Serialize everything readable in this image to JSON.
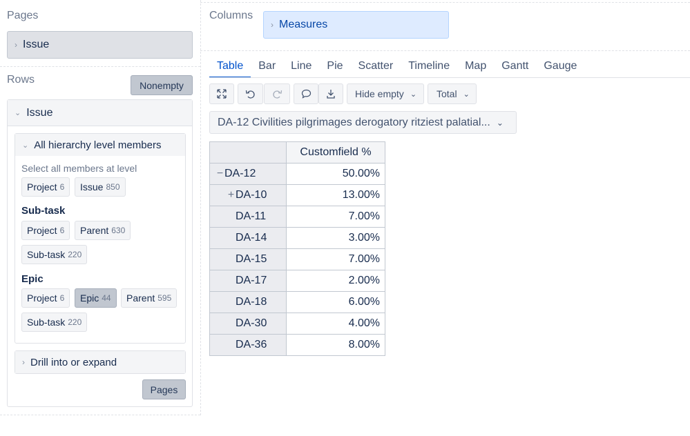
{
  "pages": {
    "title": "Pages",
    "item": "Issue"
  },
  "rows": {
    "title": "Rows",
    "nonempty_button": "Nonempty",
    "dimension": "Issue",
    "all_levels": {
      "header": "All hierarchy level members",
      "hint": "Select all members at level",
      "top_chips": [
        {
          "label": "Project",
          "count": "6"
        },
        {
          "label": "Issue",
          "count": "850"
        }
      ],
      "subtask_group": "Sub-task",
      "subtask_chips": [
        {
          "label": "Project",
          "count": "6"
        },
        {
          "label": "Parent",
          "count": "630"
        },
        {
          "label": "Sub-task",
          "count": "220"
        }
      ],
      "epic_group": "Epic",
      "epic_chips": [
        {
          "label": "Project",
          "count": "6"
        },
        {
          "label": "Epic",
          "count": "44"
        },
        {
          "label": "Parent",
          "count": "595"
        },
        {
          "label": "Sub-task",
          "count": "220"
        }
      ]
    },
    "drill": "Drill into or expand",
    "pages_button": "Pages"
  },
  "columns": {
    "title": "Columns",
    "item": "Measures"
  },
  "tabs": [
    "Table",
    "Bar",
    "Line",
    "Pie",
    "Scatter",
    "Timeline",
    "Map",
    "Gantt",
    "Gauge"
  ],
  "active_tab": "Table",
  "toolbar": {
    "hide_empty": "Hide empty",
    "total": "Total"
  },
  "selector": "DA-12 Civilities pilgrimages derogatory ritziest palatial...",
  "table": {
    "column_header": "Customfield %",
    "rows": [
      {
        "toggle": "−",
        "label": "DA-12",
        "value": "50.00%"
      },
      {
        "toggle": "+",
        "label": "DA-10",
        "value": "13.00%"
      },
      {
        "toggle": "",
        "label": "DA-11",
        "value": "7.00%"
      },
      {
        "toggle": "",
        "label": "DA-14",
        "value": "3.00%"
      },
      {
        "toggle": "",
        "label": "DA-15",
        "value": "7.00%"
      },
      {
        "toggle": "",
        "label": "DA-17",
        "value": "2.00%"
      },
      {
        "toggle": "",
        "label": "DA-18",
        "value": "6.00%"
      },
      {
        "toggle": "",
        "label": "DA-30",
        "value": "4.00%"
      },
      {
        "toggle": "",
        "label": "DA-36",
        "value": "8.00%"
      }
    ]
  }
}
